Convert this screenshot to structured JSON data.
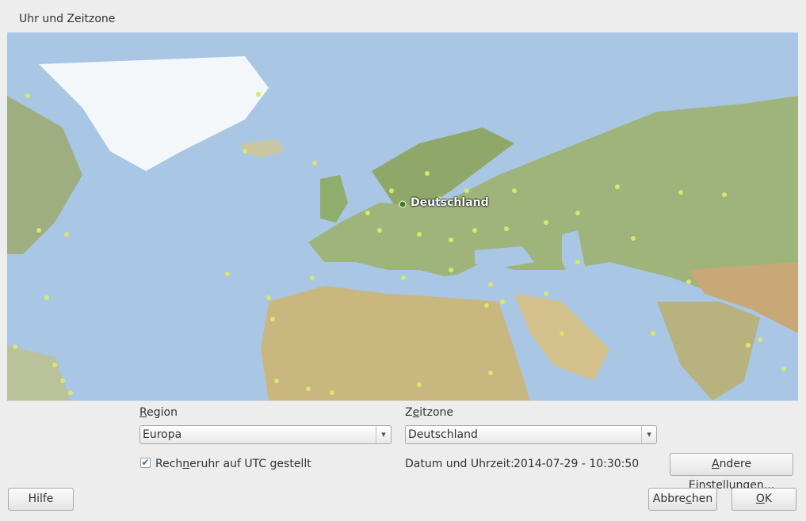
{
  "window": {
    "title": "Uhr und Zeitzone"
  },
  "map": {
    "selected_marker_label": "Deutschland",
    "colors": {
      "ocean": "#a9c6e4",
      "land": "#b9b28a",
      "ice": "#f4f7fa",
      "marker": "#d8e86a",
      "selected_marker": "#4a7a1a"
    }
  },
  "region": {
    "label_pre": "",
    "label_mnemonic": "R",
    "label_post": "egion",
    "value": "Europa"
  },
  "zone": {
    "label_pre": "Z",
    "label_mnemonic": "e",
    "label_post": "itzone",
    "value": "Deutschland"
  },
  "utc_checkbox": {
    "checked": true,
    "label_pre": "Rech",
    "label_mnemonic": "n",
    "label_post": "eruhr auf UTC gestellt"
  },
  "datetime": {
    "label": "Datum und Uhrzeit:",
    "value": "2014-07-29 - 10:30:50"
  },
  "buttons": {
    "other_settings_mnemonic": "A",
    "other_settings_rest": "ndere Einstellungen...",
    "help": "Hilfe",
    "cancel_pre": "Abbre",
    "cancel_mnemonic": "c",
    "cancel_post": "hen",
    "ok_mnemonic": "O",
    "ok_rest": "K"
  }
}
